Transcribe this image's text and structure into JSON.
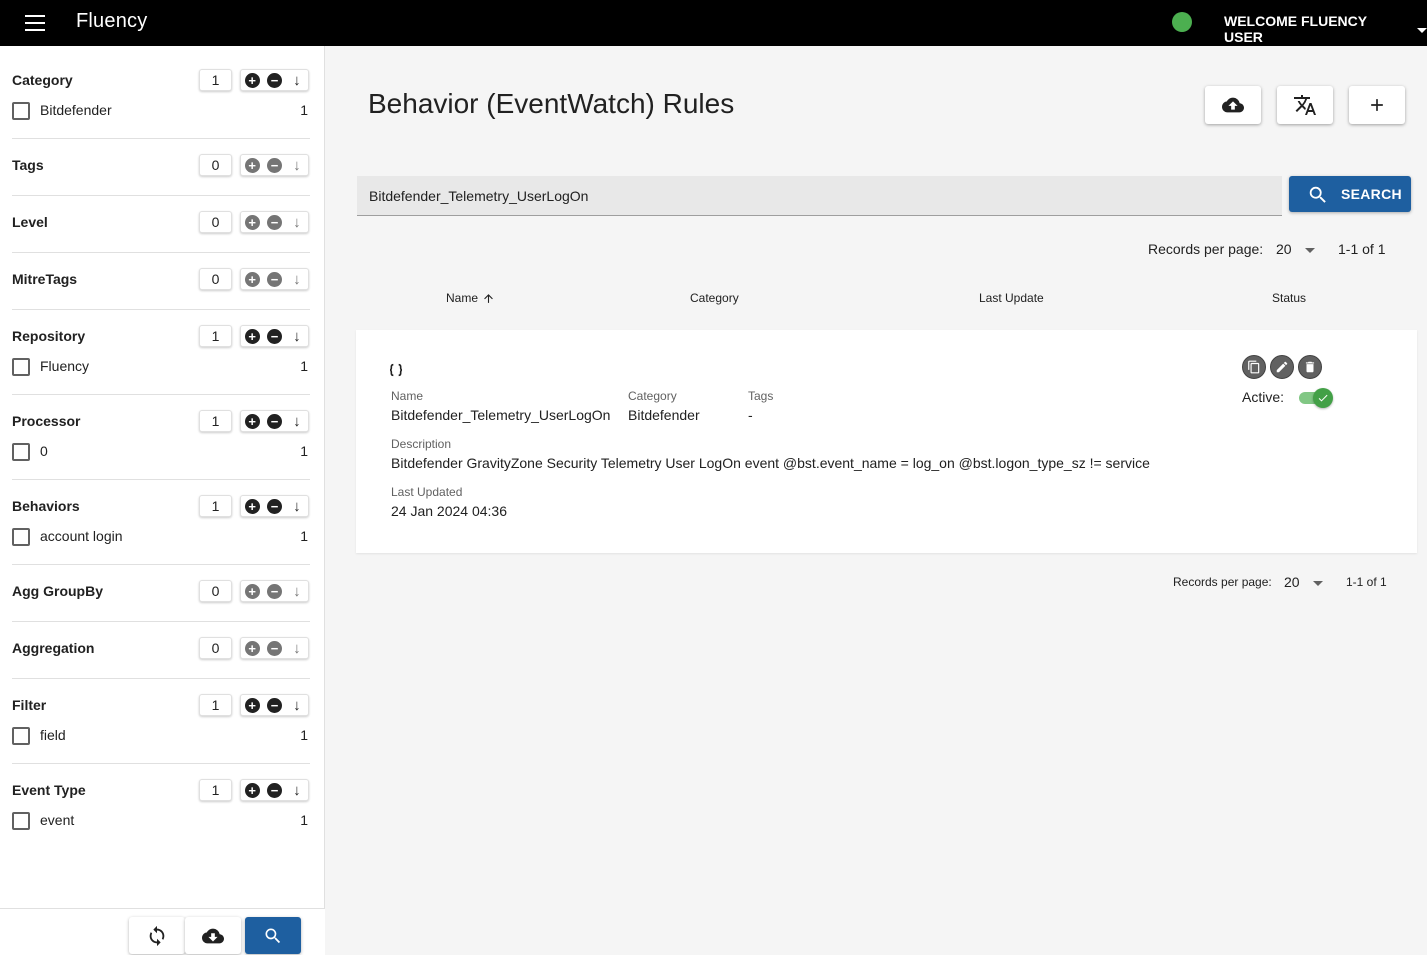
{
  "app": {
    "title": "Fluency",
    "welcome": "WELCOME FLUENCY USER",
    "status_color": "#4caf50"
  },
  "sidebar": {
    "facets": [
      {
        "title": "Category",
        "count": "1",
        "items": [
          {
            "label": "Bitdefender",
            "count": "1"
          }
        ]
      },
      {
        "title": "Tags",
        "count": "0",
        "items": []
      },
      {
        "title": "Level",
        "count": "0",
        "items": []
      },
      {
        "title": "MitreTags",
        "count": "0",
        "items": []
      },
      {
        "title": "Repository",
        "count": "1",
        "items": [
          {
            "label": "Fluency",
            "count": "1"
          }
        ]
      },
      {
        "title": "Processor",
        "count": "1",
        "items": [
          {
            "label": "0",
            "count": "1"
          }
        ]
      },
      {
        "title": "Behaviors",
        "count": "1",
        "items": [
          {
            "label": "account login",
            "count": "1"
          }
        ]
      },
      {
        "title": "Agg GroupBy",
        "count": "0",
        "items": []
      },
      {
        "title": "Aggregation",
        "count": "0",
        "items": []
      },
      {
        "title": "Filter",
        "count": "1",
        "items": [
          {
            "label": "field",
            "count": "1"
          }
        ]
      },
      {
        "title": "Event Type",
        "count": "1",
        "items": [
          {
            "label": "event",
            "count": "1"
          }
        ]
      }
    ],
    "bottom_buttons": [
      "refresh-icon",
      "cloud-download-icon",
      "search-icon"
    ]
  },
  "main": {
    "title": "Behavior (EventWatch) Rules",
    "header_buttons": [
      "cloud-upload-icon",
      "translate-icon",
      "plus-icon"
    ],
    "search": {
      "value": "Bitdefender_Telemetry_UserLogOn",
      "button_label": "SEARCH"
    },
    "pagination_top": {
      "label": "Records per page:",
      "per_page": "20",
      "range": "1-1 of 1"
    },
    "pagination_bottom": {
      "label": "Records per page:",
      "per_page": "20",
      "range": "1-1 of 1"
    },
    "columns": [
      "Name",
      "Category",
      "Last Update",
      "Status"
    ],
    "sort": {
      "column": "Name",
      "direction": "ascending"
    },
    "rule": {
      "icon": "curly-braces-icon",
      "name_label": "Name",
      "name": "Bitdefender_Telemetry_UserLogOn",
      "category_label": "Category",
      "category": "Bitdefender",
      "tags_label": "Tags",
      "tags": "-",
      "description_label": "Description",
      "description": "Bitdefender GravityZone Security Telemetry User LogOn event @bst.event_name = log_on @bst.logon_type_sz != service",
      "last_updated_label": "Last Updated",
      "last_updated": "24 Jan 2024 04:36",
      "active_label": "Active:",
      "active": true,
      "actions": [
        "copy-icon",
        "edit-icon",
        "delete-icon"
      ]
    }
  },
  "colors": {
    "primary": "#1e5fa0",
    "active_green": "#43a047",
    "topbar": "#000000"
  }
}
